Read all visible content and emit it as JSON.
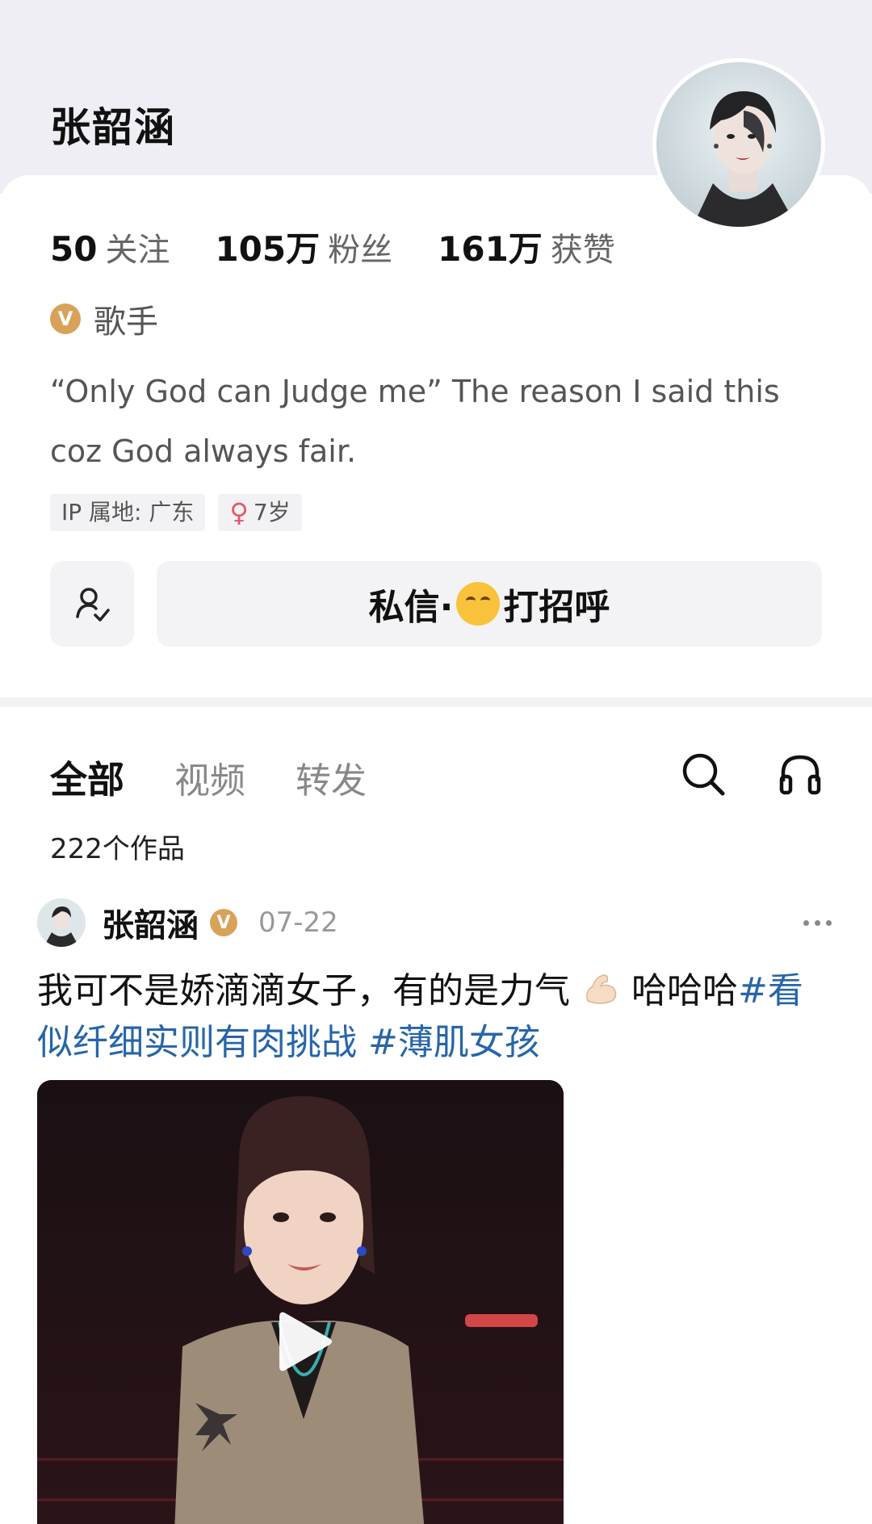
{
  "profile": {
    "display_name": "张韶涵",
    "stats": [
      {
        "num": "50",
        "label": "关注"
      },
      {
        "num": "105万",
        "label": "粉丝"
      },
      {
        "num": "161万",
        "label": "获赞"
      }
    ],
    "verified_badge": "V",
    "verified_title": "歌手",
    "bio": "“Only God can Judge me” The reason I said this coz God always fair.",
    "ip_tag": "IP 属地: 广东",
    "gender_symbol": "♀",
    "age_tag": "7岁",
    "message_button": {
      "part1": "私信·",
      "part2": "打招呼"
    }
  },
  "tabs": [
    {
      "label": "全部",
      "active": true
    },
    {
      "label": "视频",
      "active": false
    },
    {
      "label": "转发",
      "active": false
    }
  ],
  "works_count": "222个作品",
  "post": {
    "author": "张韶涵",
    "verified_badge": "V",
    "date": "07-22",
    "text_main": "我可不是娇滴滴女子，有的是力气",
    "text_laugh": "哈哈哈",
    "hashtag1": "#看似纤细实则有肉挑战",
    "hashtag2": "#薄肌女孩"
  },
  "icons": {
    "follow": "user-follow-icon",
    "search": "search-icon",
    "headphones": "headphones-icon",
    "more": "more-dots-icon",
    "play": "play-icon"
  },
  "colors": {
    "hashtag": "#2765a8",
    "badge": "#d9a25a",
    "female": "#e5566a"
  }
}
